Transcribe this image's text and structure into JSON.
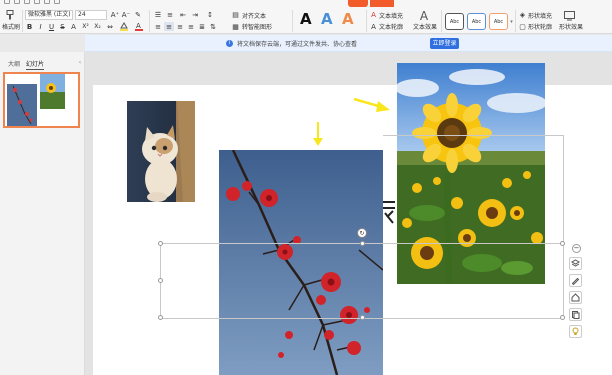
{
  "ribbon": {
    "format_painter_label": "格式刷",
    "font_name": "微软雅黑 (正文)",
    "font_size": "24",
    "bold_label": "B",
    "italic_label": "I",
    "underline_label": "U",
    "strike_label": "S",
    "superscript_label": "X²",
    "subscript_label": "X₂",
    "align_text_label": "对齐文本",
    "smart_art_label": "转智能图形",
    "art_letters": [
      "A",
      "A",
      "A"
    ],
    "text_fill_label": "文本填充",
    "text_outline_label": "文本轮廓",
    "text_effect_label": "文本效果",
    "style_boxes": [
      "Abc",
      "Abc",
      "Abc"
    ],
    "shape_fill_label": "形状填充",
    "shape_outline_label": "形状轮廓",
    "shape_effect_label": "形状效果"
  },
  "notice": {
    "text": "将文档保存云端，可通过文件发共、协心查看",
    "button_label": "立即登录"
  },
  "left_panel": {
    "tabs": [
      "大纲",
      "幻灯片"
    ]
  },
  "colors": {
    "accent": "#f25b2a",
    "link_blue": "#2f6fe0",
    "selection_border": "#f0844f",
    "arrow_yellow": "#f8e71c"
  },
  "icons": {
    "collapse": "minus-circle-icon",
    "layers": "layers-icon",
    "pen": "pen-icon",
    "home": "home-icon",
    "copy": "copy-icon",
    "bulb": "lightbulb-icon"
  }
}
